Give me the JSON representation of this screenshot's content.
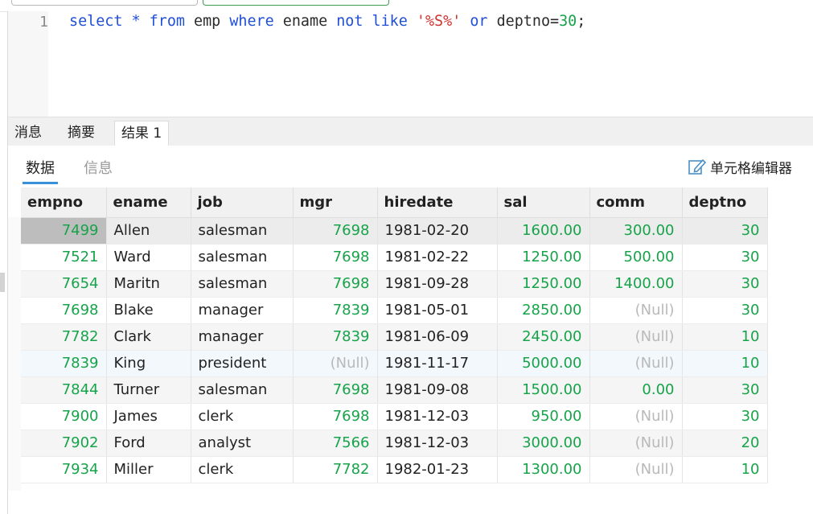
{
  "editor": {
    "line_number": "1",
    "tokens": [
      {
        "t": "select",
        "c": "kw"
      },
      {
        "t": " "
      },
      {
        "t": "*",
        "c": "kw"
      },
      {
        "t": " "
      },
      {
        "t": "from",
        "c": "kw"
      },
      {
        "t": " emp "
      },
      {
        "t": "where",
        "c": "kw"
      },
      {
        "t": " ename "
      },
      {
        "t": "not",
        "c": "kw"
      },
      {
        "t": " "
      },
      {
        "t": "like",
        "c": "kw"
      },
      {
        "t": " "
      },
      {
        "t": "'%S%'",
        "c": "str"
      },
      {
        "t": " "
      },
      {
        "t": "or",
        "c": "kw"
      },
      {
        "t": " deptno="
      },
      {
        "t": "30",
        "c": "num"
      },
      {
        "t": ";"
      }
    ]
  },
  "result_tabs": [
    {
      "label": "消息",
      "active": false
    },
    {
      "label": "摘要",
      "active": false
    },
    {
      "label": "结果 1",
      "active": true
    }
  ],
  "sub_tabs": [
    {
      "label": "数据",
      "active": true
    },
    {
      "label": "信息",
      "active": false
    }
  ],
  "cell_editor_label": "单元格编辑器",
  "colors": {
    "keyword": "#1f4fd6",
    "string": "#d0312d",
    "number": "#17a34a",
    "null": "#b9b9b9",
    "accent": "#3a8fd9"
  },
  "table": {
    "columns": [
      {
        "name": "empno",
        "width": 106,
        "align": "right"
      },
      {
        "name": "ename",
        "width": 105,
        "align": "left"
      },
      {
        "name": "job",
        "width": 127,
        "align": "left"
      },
      {
        "name": "mgr",
        "width": 105,
        "align": "right"
      },
      {
        "name": "hiredate",
        "width": 149,
        "align": "left"
      },
      {
        "name": "sal",
        "width": 115,
        "align": "right"
      },
      {
        "name": "comm",
        "width": 115,
        "align": "right"
      },
      {
        "name": "deptno",
        "width": 106,
        "align": "right"
      }
    ],
    "rows": [
      [
        "7499",
        "Allen",
        "salesman",
        "7698",
        "1981-02-20",
        "1600.00",
        "300.00",
        "30"
      ],
      [
        "7521",
        "Ward",
        "salesman",
        "7698",
        "1981-02-22",
        "1250.00",
        "500.00",
        "30"
      ],
      [
        "7654",
        "Maritn",
        "salesman",
        "7698",
        "1981-09-28",
        "1250.00",
        "1400.00",
        "30"
      ],
      [
        "7698",
        "Blake",
        "manager",
        "7839",
        "1981-05-01",
        "2850.00",
        "(Null)",
        "30"
      ],
      [
        "7782",
        "Clark",
        "manager",
        "7839",
        "1981-06-09",
        "2450.00",
        "(Null)",
        "10"
      ],
      [
        "7839",
        "King",
        "president",
        "(Null)",
        "1981-11-17",
        "5000.00",
        "(Null)",
        "10"
      ],
      [
        "7844",
        "Turner",
        "salesman",
        "7698",
        "1981-09-08",
        "1500.00",
        "0.00",
        "30"
      ],
      [
        "7900",
        "James",
        "clerk",
        "7698",
        "1981-12-03",
        "950.00",
        "(Null)",
        "30"
      ],
      [
        "7902",
        "Ford",
        "analyst",
        "7566",
        "1981-12-03",
        "3000.00",
        "(Null)",
        "20"
      ],
      [
        "7934",
        "Miller",
        "clerk",
        "7782",
        "1982-01-23",
        "1300.00",
        "(Null)",
        "10"
      ]
    ],
    "selected_row": 0,
    "hover_row": 5,
    "null_text": "(Null)"
  }
}
